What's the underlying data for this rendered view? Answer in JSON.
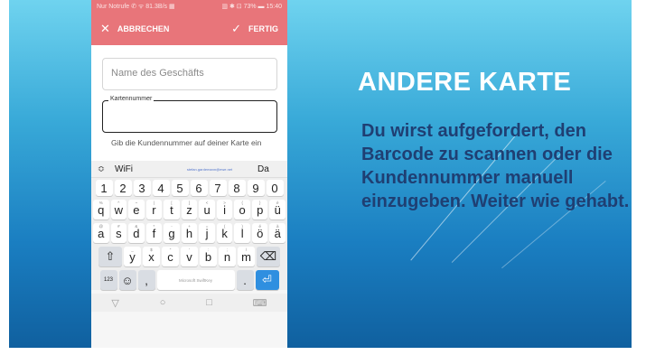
{
  "slide": {
    "title": "ANDERE KARTE",
    "body": "Du wirst aufgefordert, den Barcode zu scannen oder die Kundennummer manuell einzugeben. Weiter wie gehabt."
  },
  "phone": {
    "status": {
      "left": "Nur Notrufe ✆ ᯤ 81.3B/s ▦",
      "right": "▥ ✱ ⊡ 73% ▬ 15:40"
    },
    "actionbar": {
      "cancel_icon": "✕",
      "cancel_label": "ABBRECHEN",
      "done_icon": "✓",
      "done_label": "FERTIG"
    },
    "form": {
      "store_name_placeholder": "Name des Geschäfts",
      "card_number_label": "Kartennummer",
      "helper": "Gib die Kundennummer auf deiner Karte ein"
    },
    "suggestions": {
      "expand": "≎",
      "s1": "WiFi",
      "s2": "stefan.gardemann@ewe.net",
      "s3": "Da"
    },
    "keyboard": {
      "numbers": [
        "1",
        "2",
        "3",
        "4",
        "5",
        "6",
        "7",
        "8",
        "9",
        "0"
      ],
      "row1": [
        {
          "k": "q",
          "s": "%"
        },
        {
          "k": "w",
          "s": "^"
        },
        {
          "k": "e",
          "s": "~"
        },
        {
          "k": "r",
          "s": "|"
        },
        {
          "k": "t",
          "s": "["
        },
        {
          "k": "z",
          "s": "]"
        },
        {
          "k": "u",
          "s": "<"
        },
        {
          "k": "i",
          "s": ">"
        },
        {
          "k": "o",
          "s": "{"
        },
        {
          "k": "p",
          "s": "}"
        },
        {
          "k": "ü",
          "s": "è"
        }
      ],
      "row2": [
        {
          "k": "a",
          "s": "@"
        },
        {
          "k": "s",
          "s": "#"
        },
        {
          "k": "d",
          "s": "&"
        },
        {
          "k": "f",
          "s": "*"
        },
        {
          "k": "g",
          "s": "-"
        },
        {
          "k": "h",
          "s": "+"
        },
        {
          "k": "j",
          "s": "="
        },
        {
          "k": "k",
          "s": "("
        },
        {
          "k": "l",
          "s": ")"
        },
        {
          "k": "ö",
          "s": "é"
        },
        {
          "k": "ä",
          "s": "à"
        }
      ],
      "row3": [
        {
          "k": "y",
          "s": "_"
        },
        {
          "k": "x",
          "s": "$"
        },
        {
          "k": "c",
          "s": "\""
        },
        {
          "k": "v",
          "s": "'"
        },
        {
          "k": "b",
          "s": ":"
        },
        {
          "k": "n",
          "s": ";"
        },
        {
          "k": "m",
          "s": "/"
        }
      ],
      "shift": "⇧",
      "backspace": "⌫",
      "sym": "123",
      "emoji": "☺",
      "comma": ",",
      "space": "Microsoft SwiftKey",
      "period": ".",
      "enter": "⏎"
    },
    "nav": {
      "back": "▽",
      "home": "○",
      "recents": "□",
      "keyboard": "⌨"
    }
  },
  "colors": {
    "accent": "#e8757a",
    "enter": "#2f8fe0",
    "slide_text": "#1f3f73"
  }
}
